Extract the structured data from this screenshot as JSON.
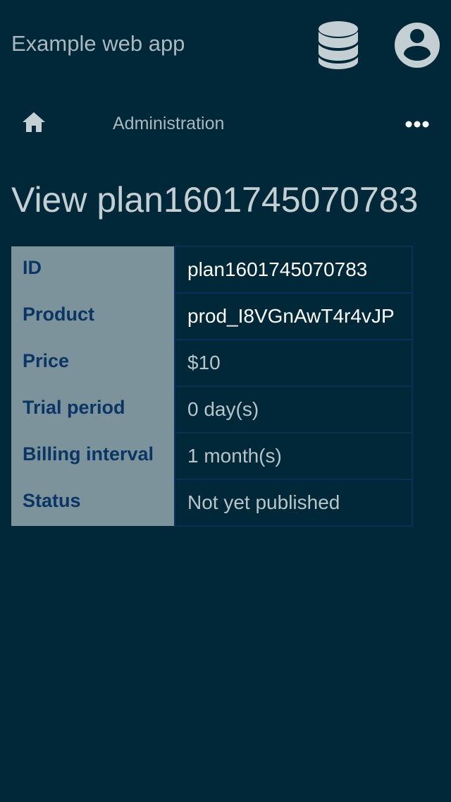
{
  "header": {
    "app_title": "Example web app",
    "database_icon": "database-icon",
    "account_icon": "user-circle-icon"
  },
  "nav": {
    "home_icon": "home-icon",
    "admin_label": "Administration",
    "more_icon": "more-horizontal-icon"
  },
  "page": {
    "title": "View plan1601745070783"
  },
  "details": [
    {
      "label": "ID",
      "value": "plan1601745070783"
    },
    {
      "label": "Product",
      "value": "prod_I8VGnAwT4r4vJP"
    },
    {
      "label": "Price",
      "value": "$10"
    },
    {
      "label": "Trial period",
      "value": "0 day(s)"
    },
    {
      "label": "Billing interval",
      "value": "1 month(s)"
    },
    {
      "label": "Status",
      "value": "Not yet published"
    }
  ],
  "colors": {
    "background": "#002838",
    "label_background": "#7d939b",
    "label_text": "#0a3564",
    "icon": "#c4cfd4",
    "table_border": "#0b2f57"
  }
}
